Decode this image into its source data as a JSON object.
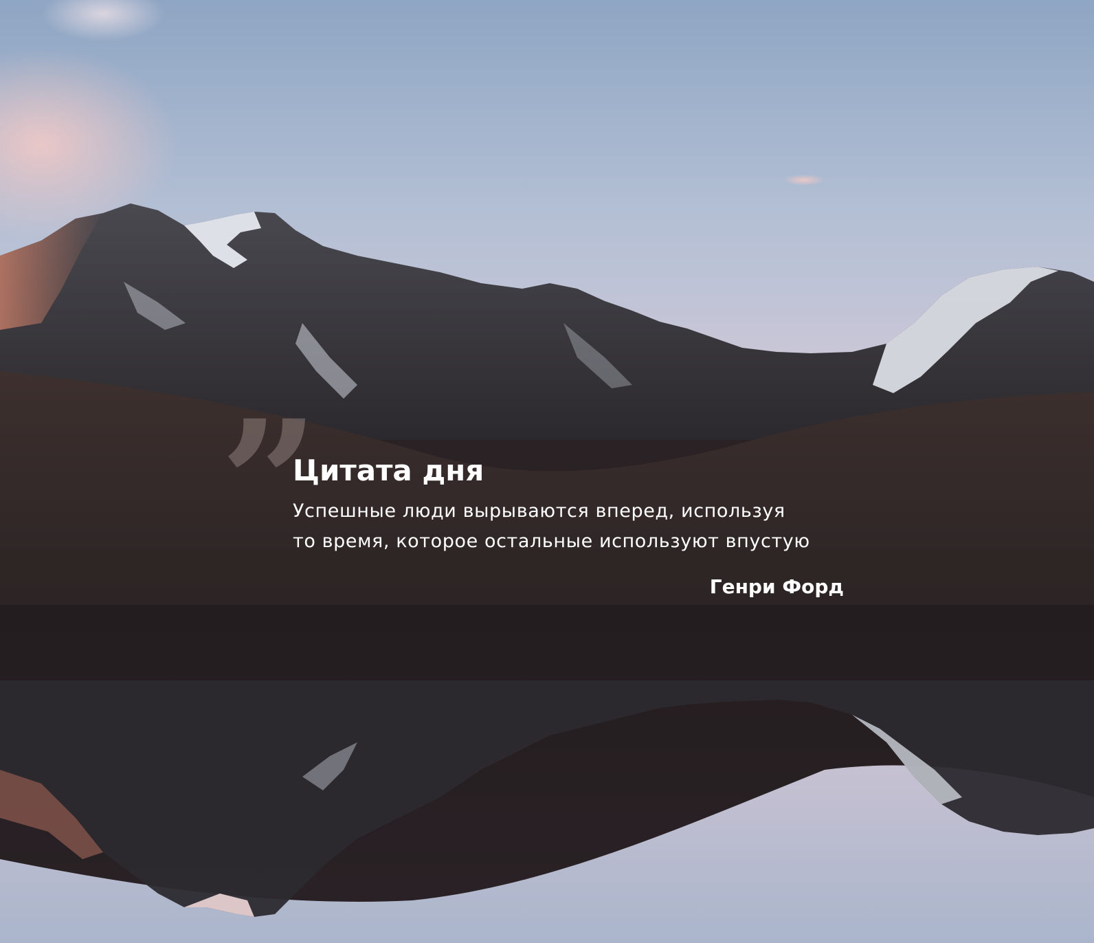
{
  "quote": {
    "title": "Цитата дня",
    "lines": [
      "Успешные люди вырываются вперед, используя",
      "то время, которое остальные используют впустую"
    ],
    "author": "Генри Форд",
    "mark_glyph": "”"
  },
  "colors": {
    "sky_top": "#8fa6c4",
    "sky_bottom": "#c8c5d6",
    "mountain_dark": "#2c2a2e",
    "snow": "#e6e8ef",
    "alpenglow": "#c98a74",
    "meadow": "#3a2e2c",
    "water_dark": "#221c1e",
    "text": "#ffffff",
    "quote_mark": "#a89692"
  }
}
